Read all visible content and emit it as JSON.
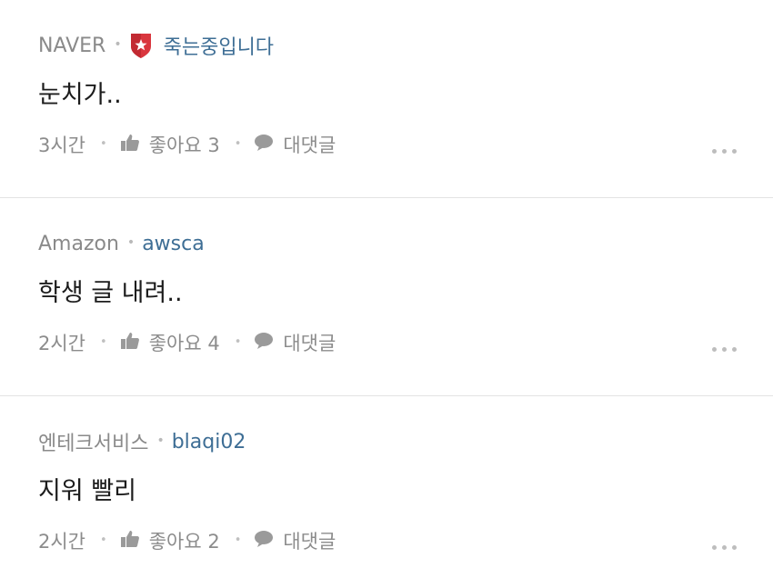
{
  "comments": [
    {
      "company": "NAVER",
      "has_badge": true,
      "badge_icon": "shield-star-icon",
      "badge_color": "#d9363e",
      "author": "죽는중입니다",
      "text": "눈치가..",
      "time": "3시간",
      "like_label": "좋아요 3",
      "reply_label": "대댓글"
    },
    {
      "company": "Amazon",
      "has_badge": false,
      "author": "awsca",
      "text": "학생 글 내려..",
      "time": "2시간",
      "like_label": "좋아요 4",
      "reply_label": "대댓글"
    },
    {
      "company": "엔테크서비스",
      "has_badge": false,
      "author": "blaqi02",
      "text": "지워 빨리",
      "time": "2시간",
      "like_label": "좋아요 2",
      "reply_label": "대댓글"
    }
  ],
  "colors": {
    "author": "#3e6e95",
    "muted": "#8c8c8c",
    "divider": "#e3e3e3"
  }
}
